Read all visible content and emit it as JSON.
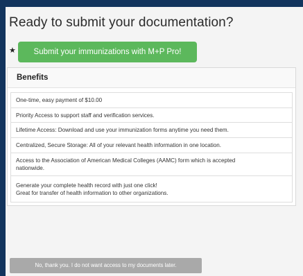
{
  "page": {
    "title": "Ready to submit your documentation?",
    "star": "★"
  },
  "submit_button": {
    "label": "Submit your immunizations with M+P Pro!"
  },
  "benefits": {
    "heading": "Benefits",
    "items": [
      {
        "lines": [
          "One-time, easy payment of $10.00"
        ]
      },
      {
        "lines": [
          "Priority Access to support staff and verification services."
        ]
      },
      {
        "lines": [
          "Lifetime Access: Download and use your immunization forms anytime you need them."
        ]
      },
      {
        "lines": [
          "Centralized, Secure Storage: All of your relevant health information in one location."
        ]
      },
      {
        "lines": [
          "Access to the Association of American Medical Colleges (AAMC) form which is accepted",
          "nationwide."
        ]
      },
      {
        "lines": [
          "Generate your complete health record with just one click!",
          "Great for transfer of health information to other organizations."
        ]
      }
    ]
  },
  "decline_button": {
    "label": "No, thank you. I do not want access to my documents later."
  },
  "colors": {
    "background": "#12345d",
    "panel": "#f4f4f4",
    "submit_button": "#5cb85c",
    "decline_button": "#a9a9a9"
  }
}
